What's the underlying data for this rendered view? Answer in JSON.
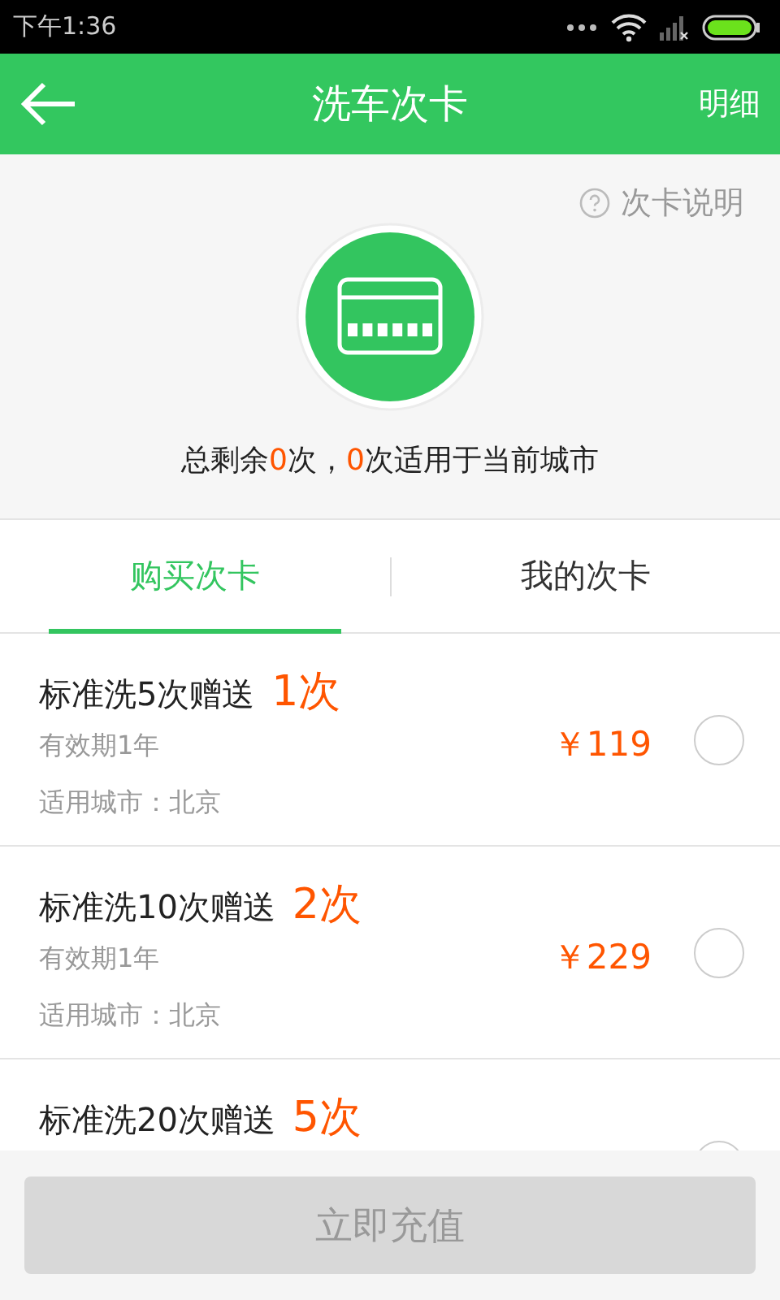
{
  "status_bar": {
    "time": "下午1:36"
  },
  "header": {
    "title": "洗车次卡",
    "action": "明细"
  },
  "info_link": "次卡说明",
  "summary": [
    {
      "text": "总剩余",
      "highlight": false
    },
    {
      "text": "0",
      "highlight": true
    },
    {
      "text": "次，",
      "highlight": false
    },
    {
      "text": "0",
      "highlight": true
    },
    {
      "text": "次适用于当前城市",
      "highlight": false
    }
  ],
  "tabs": [
    {
      "label": "购买次卡",
      "selected": true
    },
    {
      "label": "我的次卡",
      "selected": false
    }
  ],
  "cards": [
    {
      "title": "标准洗5次赠送",
      "bonus": "1次",
      "validity": "有效期1年",
      "city": "适用城市：北京",
      "price": "￥119",
      "selected": false
    },
    {
      "title": "标准洗10次赠送",
      "bonus": "2次",
      "validity": "有效期1年",
      "city": "适用城市：北京",
      "price": "￥229",
      "selected": false
    },
    {
      "title": "标准洗20次赠送",
      "bonus": "5次",
      "selected": false
    }
  ],
  "submit": {
    "label": "立即充值",
    "disabled": true
  }
}
